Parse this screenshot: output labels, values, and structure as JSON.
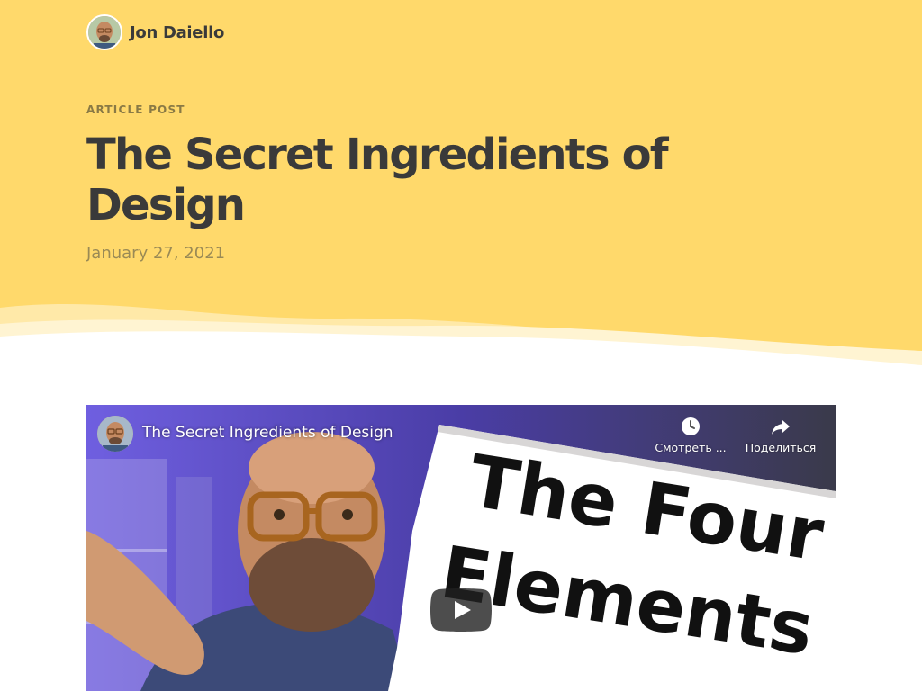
{
  "header": {
    "author_name": "Jon Daiello",
    "avatar_icon": "author-avatar"
  },
  "article": {
    "kicker": "ARTICLE POST",
    "title": "The Secret Ingredients of Design",
    "date": "January 27, 2021"
  },
  "video": {
    "title": "The Secret Ingredients of Design",
    "thumbnail_text": [
      "The Four",
      "Elements"
    ],
    "watch_later_label": "Смотреть ...",
    "share_label": "Поделиться",
    "icons": [
      "channel-avatar",
      "clock-icon",
      "share-icon",
      "play-icon"
    ]
  },
  "colors": {
    "hero_background": "#ffd96b",
    "heading_text": "#3a3a3a",
    "date_text": "#9a8a55",
    "kicker_text": "#8a7a45"
  }
}
